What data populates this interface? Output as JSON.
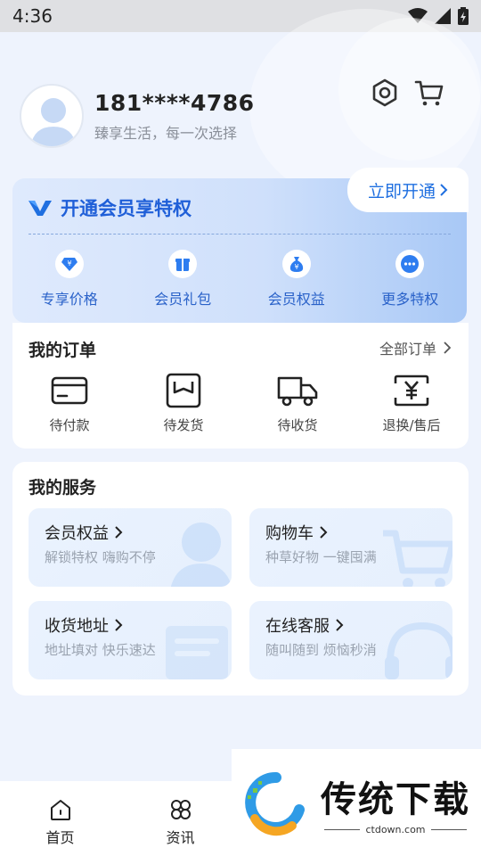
{
  "status_bar": {
    "time": "4:36"
  },
  "profile": {
    "phone": "181****4786",
    "slogan": "臻享生活，每一次选择"
  },
  "header_icons": [
    "settings-icon",
    "cart-icon"
  ],
  "vip": {
    "title": "开通会员享特权",
    "cta": "立即开通",
    "items": [
      {
        "label": "专享价格",
        "icon": "price-icon"
      },
      {
        "label": "会员礼包",
        "icon": "gift-icon"
      },
      {
        "label": "会员权益",
        "icon": "money-bag-icon"
      },
      {
        "label": "更多特权",
        "icon": "more-icon"
      }
    ]
  },
  "orders": {
    "title": "我的订单",
    "all_label": "全部订单",
    "items": [
      {
        "label": "待付款",
        "icon": "card-icon"
      },
      {
        "label": "待发货",
        "icon": "box-icon"
      },
      {
        "label": "待收货",
        "icon": "truck-icon"
      },
      {
        "label": "退换/售后",
        "icon": "yuan-icon"
      }
    ]
  },
  "services": {
    "title": "我的服务",
    "items": [
      {
        "title": "会员权益",
        "subtitle": "解锁特权 嗨购不停"
      },
      {
        "title": "购物车",
        "subtitle": "种草好物 一键囤满"
      },
      {
        "title": "收货地址",
        "subtitle": "地址填对 快乐速达"
      },
      {
        "title": "在线客服",
        "subtitle": "随叫随到 烦恼秒消"
      }
    ]
  },
  "tabbar": [
    {
      "label": "首页",
      "icon": "home-icon"
    },
    {
      "label": "资讯",
      "icon": "clover-icon"
    }
  ],
  "watermark": {
    "brand": "传统下载",
    "url": "ctdown.com"
  },
  "colors": {
    "accent": "#1f6fe0",
    "background": "#eef3fd",
    "vip_text": "#2a62c9"
  }
}
